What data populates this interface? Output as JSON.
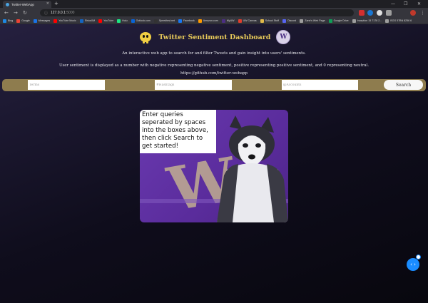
{
  "browser": {
    "tab_title": "Twitter-WebApp",
    "tab_close": "×",
    "new_tab": "+",
    "window_controls": [
      "—",
      "❐",
      "✕"
    ],
    "nav": {
      "back": "←",
      "forward": "→",
      "reload": "↻",
      "lock": "ⓘ"
    },
    "url_host": "127.0.0.1",
    "url_port": ":5000",
    "bookmarks": [
      {
        "label": "Bing",
        "color": "#1e88e5"
      },
      {
        "label": "Google",
        "color": "#ea4335"
      },
      {
        "label": "Messages",
        "color": "#1a73e8"
      },
      {
        "label": "YouTube Music",
        "color": "#ff0000"
      },
      {
        "label": "SiriusXM",
        "color": "#1565c0"
      },
      {
        "label": "YouTube",
        "color": "#ff0000"
      },
      {
        "label": "Hulu",
        "color": "#1ce783"
      },
      {
        "label": "Outlook.com",
        "color": "#0a64d6"
      },
      {
        "label": "Speedtest.net",
        "color": "#333333"
      },
      {
        "label": "Facebook",
        "color": "#1877f2"
      },
      {
        "label": "Amazon.com",
        "color": "#ff9900"
      },
      {
        "label": "MyUW",
        "color": "#4b2e83"
      },
      {
        "label": "UW Canvas",
        "color": "#e03e2d"
      },
      {
        "label": "School Stuff",
        "color": "#e0b84a"
      },
      {
        "label": "Discord",
        "color": "#5865f2"
      },
      {
        "label": "Zane's Web Page",
        "color": "#9e9e9e"
      },
      {
        "label": "Google Drive",
        "color": "#0f9d58"
      },
      {
        "label": "Inception 15 7178 2...",
        "color": "#9e9e9e"
      },
      {
        "label": "BOG 57BN 8256 6",
        "color": "#9e9e9e"
      }
    ]
  },
  "header": {
    "title": "Twitter Sentiment Dashboard",
    "uw_logo_letter": "W"
  },
  "intro": {
    "line1": "An interactive web app to search for and filter Tweets and gain insight into users' sentiments.",
    "line2": "User sentiment is displayed as a number with negative representing negative sentiment, positive representing positive sentiment, and 0 representing neutral.",
    "repo": "https://github.com/twitter-webapp"
  },
  "search": {
    "terms_placeholder": "Terms",
    "hashtags_placeholder": "#Hashtags",
    "accounts_placeholder": "@Accounts",
    "button_label": "Search"
  },
  "hero": {
    "hint": "Enter queries seperated by spaces into the boxes above, then click Search to get started!",
    "banner_letter": "W"
  },
  "fab": {
    "label": "‹ ›"
  },
  "colors": {
    "accent_gold": "#e9cb5a",
    "search_bar": "#8e7c4e",
    "uw_purple": "#4b2e83",
    "fab_blue": "#1a8cff"
  }
}
